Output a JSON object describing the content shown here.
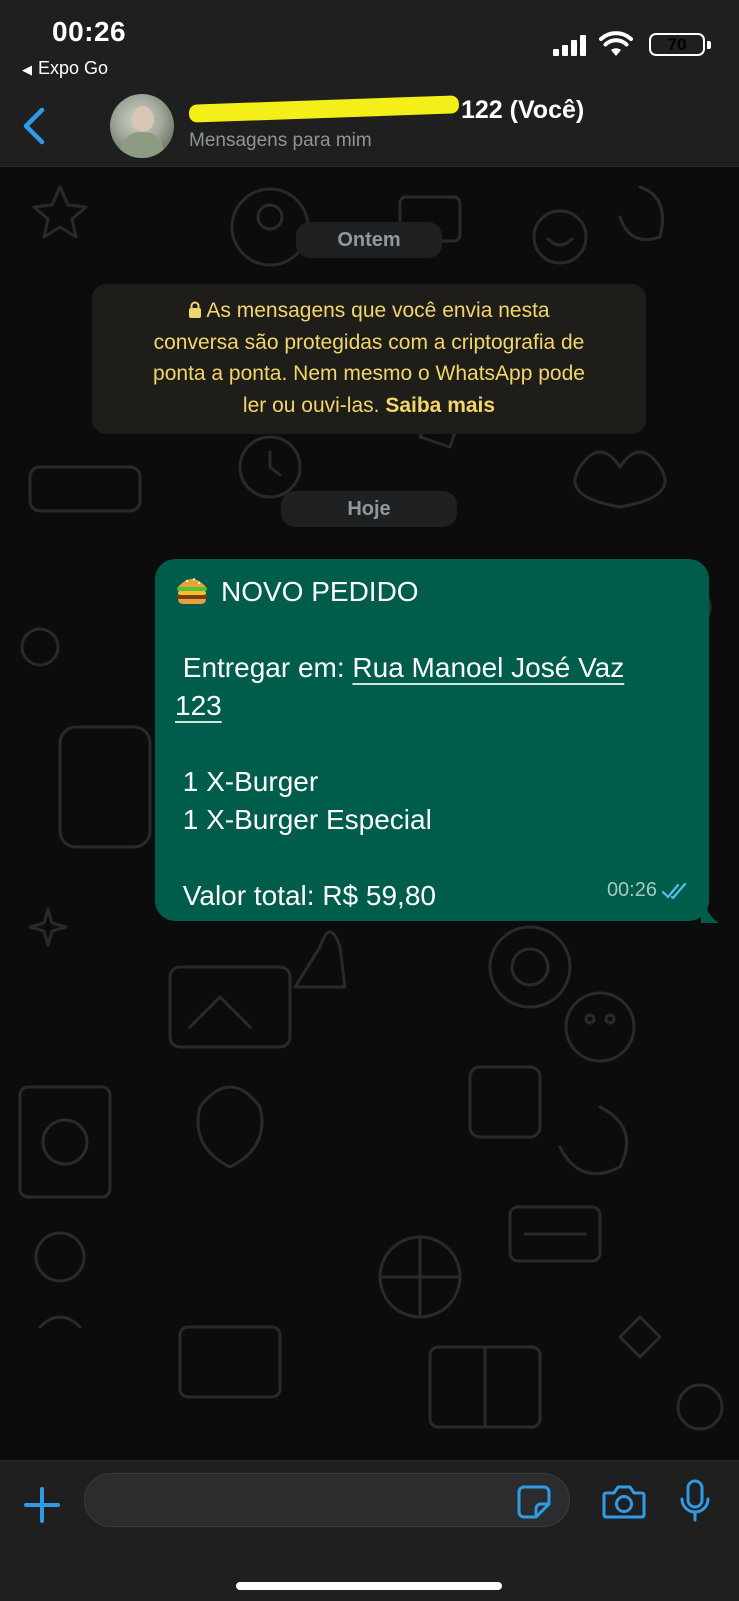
{
  "status_bar": {
    "time": "00:26",
    "back_app": "Expo Go",
    "battery": "70"
  },
  "header": {
    "contact_name_visible": "122 (Você)",
    "subtitle": "Mensagens para mim"
  },
  "chat": {
    "date_yesterday": "Ontem",
    "encryption_notice": {
      "lines": [
        "As mensagens que você envia nesta",
        "conversa são protegidas com a criptografia de",
        "ponta a ponta. Nem mesmo o WhatsApp pode",
        "ler ou ouvi-las."
      ],
      "learn_more": "Saiba mais"
    },
    "date_today": "Hoje",
    "message": {
      "title": "NOVO PEDIDO",
      "deliver_label": " Entregar em: ",
      "address_line1": "Rua Manoel José Vaz",
      "address_line2": "123",
      "item1": " 1 X-Burger",
      "item2": " 1 X-Burger Especial",
      "total": " Valor total: R$ 59,80",
      "time": "00:26"
    }
  },
  "composer": {
    "input_value": "",
    "input_placeholder": ""
  },
  "colors": {
    "accent_blue": "#2f9be6",
    "bubble_green": "#005c4b",
    "encryption_text": "#f2d66a",
    "header_bg": "#1f1f1f"
  },
  "icons": [
    "chevron-left-icon",
    "lock-icon",
    "burger-emoji-icon",
    "double-check-icon",
    "plus-icon",
    "sticker-icon",
    "camera-icon",
    "microphone-icon"
  ]
}
